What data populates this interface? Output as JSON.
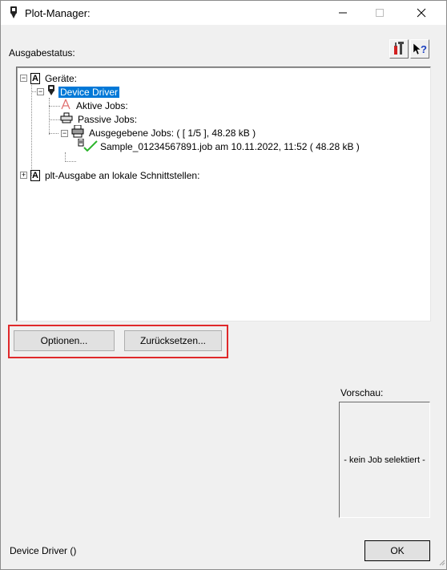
{
  "window": {
    "title": "Plot-Manager:",
    "icon": "plotter-icon"
  },
  "titlebar_buttons": {
    "minimize": "—",
    "maximize": "☐",
    "close": "✕"
  },
  "status_label": "Ausgabestatus:",
  "toolbar": {
    "settings_icon": "tools-icon",
    "help_icon": "context-help-icon",
    "help_glyph": "?"
  },
  "tree": {
    "root_device": {
      "letter": "A",
      "label": "Geräte:"
    },
    "device_driver": {
      "label": "Device Driver"
    },
    "active_jobs": {
      "label": "Aktive Jobs:"
    },
    "passive_jobs": {
      "label": "Passive Jobs:"
    },
    "output_jobs": {
      "label": "Ausgegebene Jobs: ( [ 1/5 ], 48.28 kB )"
    },
    "job_item": {
      "label": "Sample_01234567891.job am 10.11.2022, 11:52 ( 48.28 kB )"
    },
    "plt_output": {
      "letter": "A",
      "label": "plt-Ausgabe an lokale Schnittstellen:"
    },
    "expand_minus": "−",
    "expand_plus": "+"
  },
  "buttons": {
    "options": "Optionen...",
    "reset": "Zurücksetzen..."
  },
  "preview": {
    "label": "Vorschau:",
    "content": "- kein Job selektiert -"
  },
  "status_bar": {
    "text": "Device Driver ()"
  },
  "ok_button": "OK",
  "colors": {
    "selection": "#0078d7",
    "highlight_box": "#e0292b",
    "check_green": "#2db52d"
  }
}
